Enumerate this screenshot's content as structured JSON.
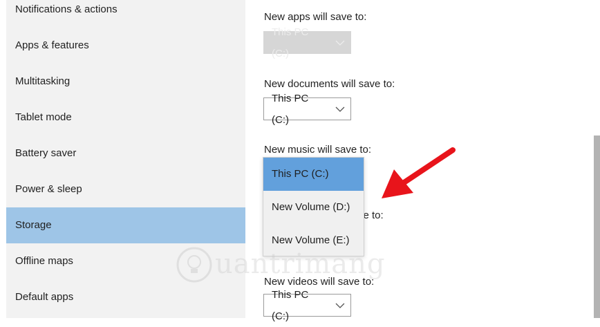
{
  "sidebar": {
    "items": [
      {
        "label": "Notifications & actions"
      },
      {
        "label": "Apps & features"
      },
      {
        "label": "Multitasking"
      },
      {
        "label": "Tablet mode"
      },
      {
        "label": "Battery saver"
      },
      {
        "label": "Power & sleep"
      },
      {
        "label": "Storage"
      },
      {
        "label": "Offline maps"
      },
      {
        "label": "Default apps"
      }
    ],
    "selected": "Storage"
  },
  "content": {
    "apps": {
      "label": "New apps will save to:",
      "value": "This PC (C:)",
      "enabled": false
    },
    "documents": {
      "label": "New documents will save to:",
      "value": "This PC (C:)"
    },
    "music": {
      "label": "New music will save to:",
      "value": "This PC (C:)"
    },
    "hidden_label_fragment": "ve to:",
    "videos": {
      "label": "New videos will save to:",
      "value": "This PC (C:)"
    }
  },
  "music_dropdown_options": [
    {
      "label": "This PC (C:)",
      "selected": true
    },
    {
      "label": "New Volume (D:)",
      "selected": false
    },
    {
      "label": "New Volume (E:)",
      "selected": false
    }
  ],
  "watermark": {
    "text": "uantrimang"
  },
  "colors": {
    "sidebar_bg": "#f2f2f2",
    "selected_item": "#9ec5e7",
    "selected_option": "#62a0dc",
    "arrow": "#e8141b"
  },
  "icons": {
    "chevron": "chevron-down-icon",
    "arrow": "red-arrow-annotation",
    "watermark_logo": "lightbulb-icon"
  }
}
